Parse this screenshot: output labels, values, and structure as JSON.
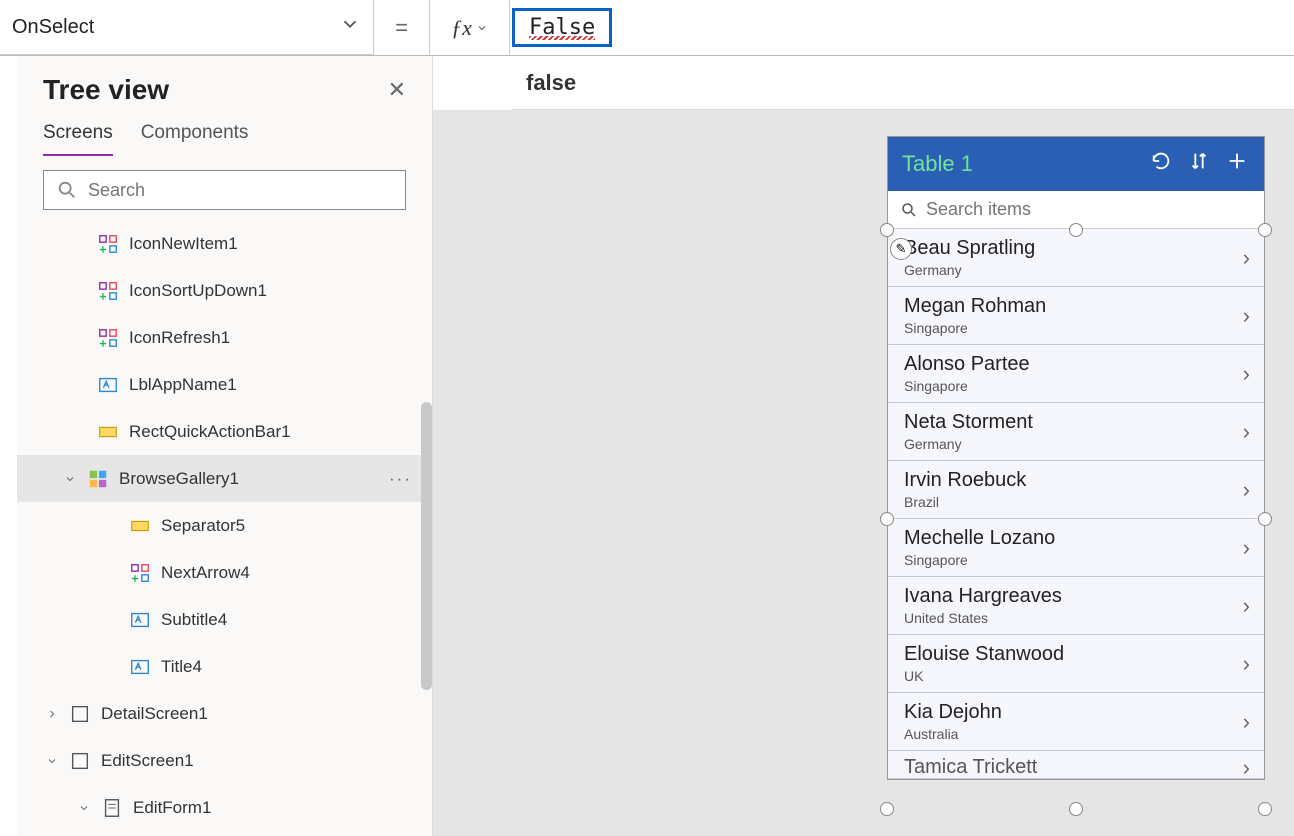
{
  "formula": {
    "property": "OnSelect",
    "expression": "False",
    "suggestion": "false"
  },
  "tree": {
    "title": "Tree view",
    "tabs": {
      "screens": "Screens",
      "components": "Components"
    },
    "search_placeholder": "Search",
    "items": [
      {
        "label": "IconNewItem1"
      },
      {
        "label": "IconSortUpDown1"
      },
      {
        "label": "IconRefresh1"
      },
      {
        "label": "LblAppName1"
      },
      {
        "label": "RectQuickActionBar1"
      },
      {
        "label": "BrowseGallery1"
      },
      {
        "label": "Separator5"
      },
      {
        "label": "NextArrow4"
      },
      {
        "label": "Subtitle4"
      },
      {
        "label": "Title4"
      },
      {
        "label": "DetailScreen1"
      },
      {
        "label": "EditScreen1"
      },
      {
        "label": "EditForm1"
      }
    ]
  },
  "phone": {
    "title": "Table 1",
    "search_placeholder": "Search items",
    "rows": [
      {
        "name": "Beau Spratling",
        "sub": "Germany"
      },
      {
        "name": "Megan Rohman",
        "sub": "Singapore"
      },
      {
        "name": "Alonso Partee",
        "sub": "Singapore"
      },
      {
        "name": "Neta Storment",
        "sub": "Germany"
      },
      {
        "name": "Irvin Roebuck",
        "sub": "Brazil"
      },
      {
        "name": "Mechelle Lozano",
        "sub": "Singapore"
      },
      {
        "name": "Ivana Hargreaves",
        "sub": "United States"
      },
      {
        "name": "Elouise Stanwood",
        "sub": "UK"
      },
      {
        "name": "Kia Dejohn",
        "sub": "Australia"
      },
      {
        "name": "Tamica Trickett",
        "sub": ""
      }
    ]
  }
}
